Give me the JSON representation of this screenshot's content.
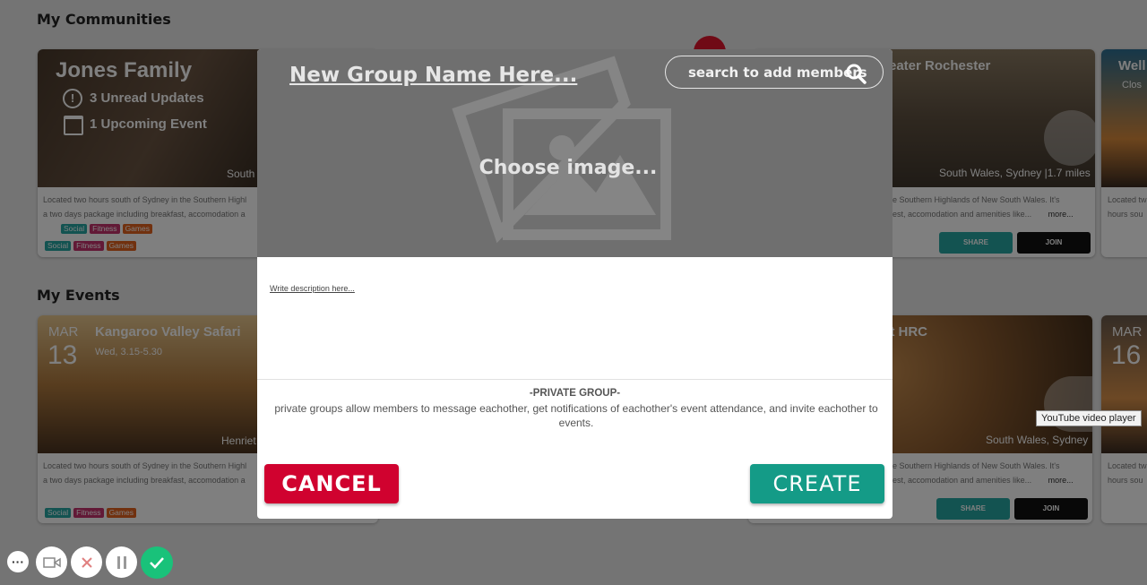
{
  "sections": {
    "communities_title": "My Communities",
    "events_title": "My Events"
  },
  "communities": {
    "jones": {
      "title": "Jones Family",
      "updates": "3 Unread Updates",
      "upcoming": "1 Upcoming Event",
      "location_partial": "South",
      "desc_line1": "Located two hours south of Sydney in the Southern Highl",
      "desc_line2": "a two days package including breakfast, accomodation a",
      "tags_row1": [
        "Social",
        "Fitness",
        "Games"
      ],
      "tags_row2": [
        "Social",
        "Fitness",
        "Games"
      ]
    },
    "rochester": {
      "title_partial": "eater Rochester",
      "location": "South Wales, Sydney |1.7 miles",
      "desc_line1": "e Southern Highlands of New South Wales. It's",
      "desc_line2": "est, accomodation and amenities like...",
      "more": "more...",
      "share": "SHARE",
      "join": "JOIN"
    },
    "right": {
      "title_partial": "Well",
      "sub_partial": "Clos",
      "desc_line1": "Located tw",
      "desc_line2": "hours sou"
    }
  },
  "events": {
    "safari": {
      "month": "MAR",
      "day": "13",
      "title": "Kangaroo Valley Safari",
      "time": "Wed, 3.15-5.30",
      "location_partial": "Henriet",
      "desc_line1": "Located two hours south of Sydney in the Southern Highl",
      "desc_line2": "a two days package including breakfast, accomodation a",
      "tags": [
        "Social",
        "Fitness",
        "Games"
      ]
    },
    "hrc": {
      "title_partial": "at HRC",
      "location": "South Wales, Sydney",
      "desc_line1": "e Southern Highlands of New South Wales. It's",
      "desc_line2": "est, accomodation and amenities like...",
      "more": "more...",
      "share": "SHARE",
      "join": "JOIN"
    },
    "right": {
      "month": "MAR",
      "day": "16",
      "desc_line1": "Located tw",
      "desc_line2": "hours sou"
    }
  },
  "modal": {
    "group_name": "New Group Name Here...",
    "search_placeholder": "search to add members",
    "choose_image": "Choose image...",
    "description_placeholder": "Write description here...",
    "private_title": "-PRIVATE GROUP-",
    "private_text": "private groups allow members to message eachother, get notifications of eachother's event attendance, and invite eachother to events.",
    "cancel_label": "CANCEL",
    "create_label": "CREATE"
  },
  "tooltip": "YouTube video player",
  "colors": {
    "cancel": "#d0022f",
    "create": "#149b87",
    "social": "#27a6a3",
    "fitness": "#c4336c",
    "games": "#e2631f",
    "confirm": "#19c27a"
  }
}
